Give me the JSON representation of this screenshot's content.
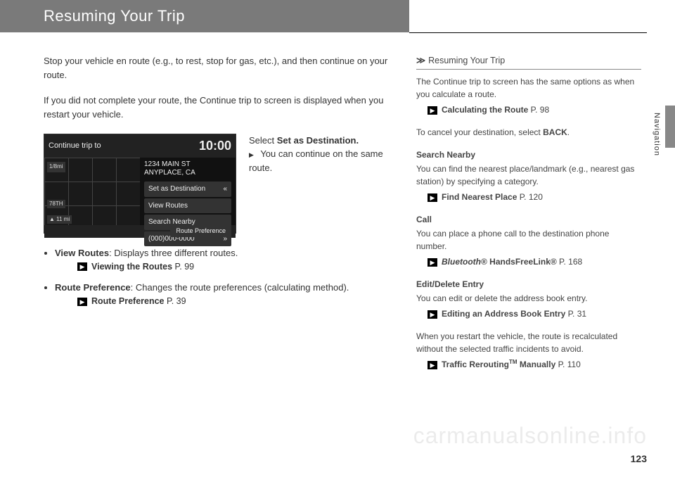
{
  "header": {
    "title": "Resuming Your Trip"
  },
  "main": {
    "intro1": "Stop your vehicle en route (e.g., to rest, stop for gas, etc.), and then continue on your route.",
    "intro2": "If you did not complete your route, the Continue trip to screen is displayed when you restart your vehicle.",
    "screen": {
      "topLabel": "Continue trip to",
      "clock": "10:00",
      "addr1": "1234 MAIN ST",
      "addr2": "ANYPLACE, CA",
      "items": {
        "a": "Set as Destination",
        "b": "View Routes",
        "c": "Search Nearby",
        "d": "(000)000-0000"
      },
      "bottomBtn": "Route Preference",
      "scale": "1/8mi",
      "street": "78TH",
      "compass": "▲  11 mi"
    },
    "instr": {
      "line1a": "Select ",
      "line1b": "Set as Destination.",
      "line2": "You can continue on the same route."
    },
    "bullets": {
      "b1_strong": "View Routes",
      "b1_rest": ": Displays three different routes.",
      "b1_xref": "Viewing the Routes",
      "b1_page": " P. 99",
      "b2_strong": "Route Preference",
      "b2_rest": ": Changes the route preferences (calculating method).",
      "b2_xref": "Route Preference",
      "b2_page": " P. 39"
    }
  },
  "side": {
    "head": "Resuming Your Trip",
    "p1": "The Continue trip to screen has the same options as when you calculate a route.",
    "x1": "Calculating the Route",
    "x1p": " P. 98",
    "p2a": "To cancel your destination, select ",
    "p2b": "BACK",
    "p2c": ".",
    "s1t": "Search Nearby",
    "s1b": "You can find the nearest place/landmark (e.g., nearest gas station) by specifying a category.",
    "x2": "Find Nearest Place",
    "x2p": " P. 120",
    "s2t": "Call",
    "s2b": "You can place a phone call to the destination phone number.",
    "x3a": "Bluetooth",
    "x3b": "® HandsFreeLink®",
    "x3p": " P. 168",
    "s3t": "Edit/Delete Entry",
    "s3b": "You can edit or delete the address book entry.",
    "x4": "Editing an Address Book Entry",
    "x4p": " P. 31",
    "p3": "When you restart the vehicle, the route is recalculated without the selected traffic incidents to avoid.",
    "x5a": "Traffic Rerouting",
    "x5b": "TM",
    "x5c": " Manually",
    "x5p": " P. 110"
  },
  "sideLabel": "Navigation",
  "pageNum": "123",
  "watermark": "carmanualsonline.info"
}
